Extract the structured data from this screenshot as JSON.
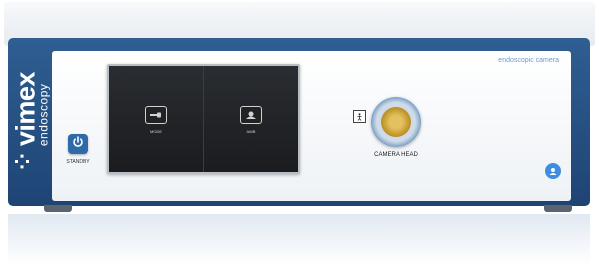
{
  "brand": {
    "logo_glyph": "⁘",
    "name": "vimex",
    "sub": "endoscopy",
    "color": "#ffffff"
  },
  "product": {
    "label": "endoscopic camera"
  },
  "standby": {
    "label": "STANDBY",
    "icon": "power-icon"
  },
  "screen": {
    "buttons": [
      {
        "label": "MODE",
        "icon": "endoscope-mode-icon"
      },
      {
        "label": "AWB",
        "icon": "white-balance-icon"
      }
    ]
  },
  "connector": {
    "label": "CAMERA HEAD",
    "symbol_icon": "bf-applied-part-icon"
  },
  "badge": {
    "icon": "service-icon"
  },
  "colors": {
    "housing": "#2a5587",
    "panel": "#f4f6f9",
    "accent": "#3d8ee0",
    "screen": "#1d1f22"
  }
}
